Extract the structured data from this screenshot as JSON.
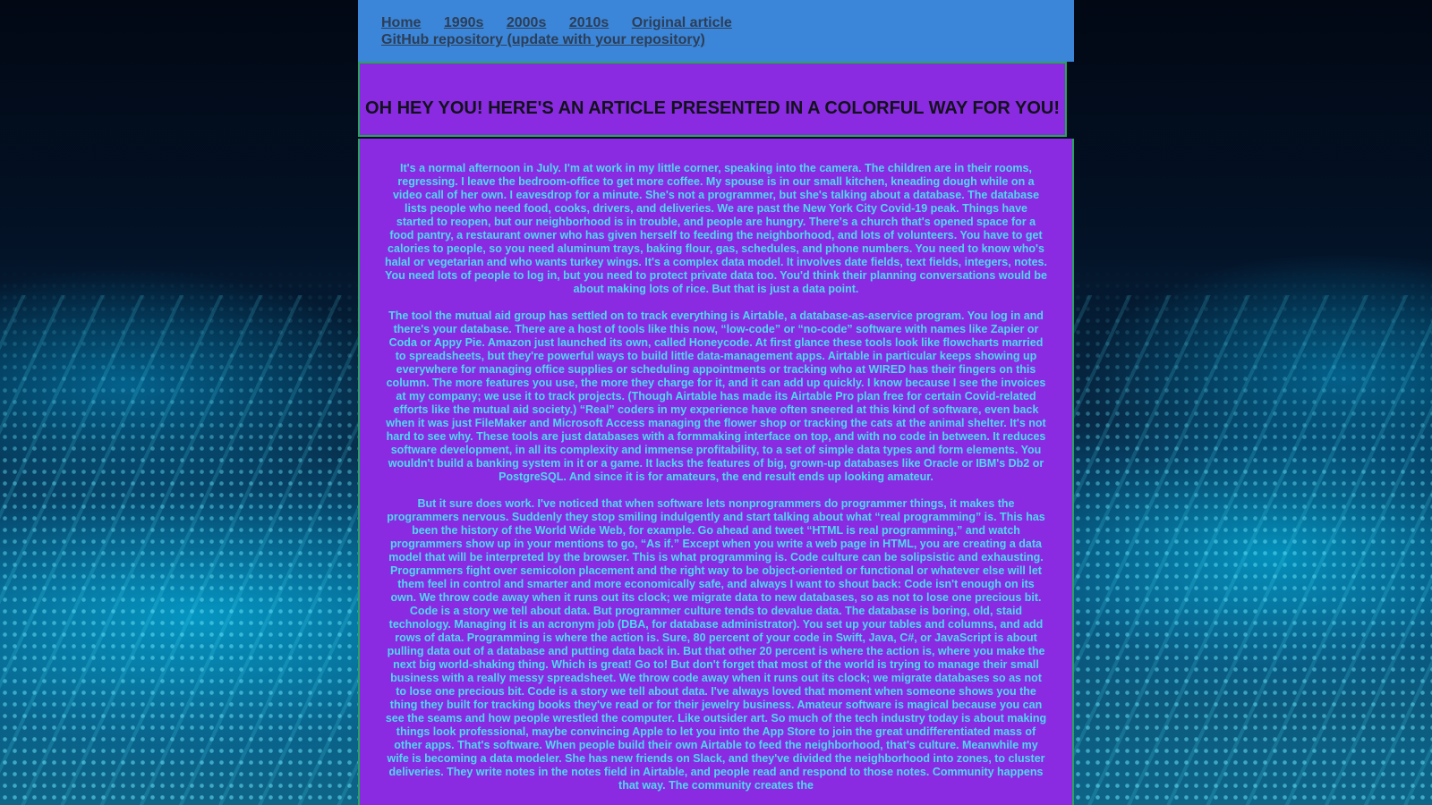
{
  "nav": {
    "links": [
      "Home",
      "1990s",
      "2000s",
      "2010s",
      "Original article"
    ],
    "repo_link": "GitHub repository (update with your repository)"
  },
  "banner": {
    "title": "OH HEY YOU! HERE'S AN ARTICLE PRESENTED IN A COLORFUL WAY FOR YOU!"
  },
  "article": {
    "paragraphs": [
      "It's a normal afternoon in July. I'm at work in my little corner, speaking into the camera. The children are in their rooms, regressing. I leave the bedroom-office to get more coffee. My spouse is in our small kitchen, kneading dough while on a video call of her own. I eavesdrop for a minute. She's not a programmer, but she's talking about a database. The database lists people who need food, cooks, drivers, and deliveries. We are past the New York City Covid-19 peak. Things have started to reopen, but our neighborhood is in trouble, and people are hungry. There's a church that's opened space for a food pantry, a restaurant owner who has given herself to feeding the neighborhood, and lots of volunteers. You have to get calories to people, so you need aluminum trays, baking flour, gas, schedules, and phone numbers. You need to know who's halal or vegetarian and who wants turkey wings. It's a complex data model. It involves date fields, text fields, integers, notes. You need lots of people to log in, but you need to protect private data too. You'd think their planning conversations would be about making lots of rice. But that is just a data point.",
      "The tool the mutual aid group has settled on to track everything is Airtable, a database-as-aservice program. You log in and there's your database. There are a host of tools like this now, “low-code” or “no-code” software with names like Zapier or Coda or Appy Pie. Amazon just launched its own, called Honeycode. At first glance these tools look like flowcharts married to spreadsheets, but they're powerful ways to build little data-management apps. Airtable in particular keeps showing up everywhere for managing office supplies or scheduling appointments or tracking who at WIRED has their fingers on this column. The more features you use, the more they charge for it, and it can add up quickly. I know because I see the invoices at my company; we use it to track projects. (Though Airtable has made its Airtable Pro plan free for certain Covid-related efforts like the mutual aid society.) “Real” coders in my experience have often sneered at this kind of software, even back when it was just FileMaker and Microsoft Access managing the flower shop or tracking the cats at the animal shelter. It's not hard to see why. These tools are just databases with a formmaking interface on top, and with no code in between. It reduces software development, in all its complexity and immense profitability, to a set of simple data types and form elements. You wouldn't build a banking system in it or a game. It lacks the features of big, grown-up databases like Oracle or IBM's Db2 or PostgreSQL. And since it is for amateurs, the end result ends up looking amateur.",
      "But it sure does work. I've noticed that when software lets nonprogrammers do programmer things, it makes the programmers nervous. Suddenly they stop smiling indulgently and start talking about what “real programming” is. This has been the history of the World Wide Web, for example. Go ahead and tweet “HTML is real programming,” and watch programmers show up in your mentions to go, “As if.” Except when you write a web page in HTML, you are creating a data model that will be interpreted by the browser. This is what programming is. Code culture can be solipsistic and exhausting. Programmers fight over semicolon placement and the right way to be object-oriented or functional or whatever else will let them feel in control and smarter and more economically safe, and always I want to shout back: Code isn't enough on its own. We throw code away when it runs out its clock; we migrate data to new databases, so as not to lose one precious bit. Code is a story we tell about data. But programmer culture tends to devalue data. The database is boring, old, staid technology. Managing it is an acronym job (DBA, for database administrator). You set up your tables and columns, and add rows of data. Programming is where the action is. Sure, 80 percent of your code in Swift, Java, C#, or JavaScript is about pulling data out of a database and putting data back in. But that other 20 percent is where the action is, where you make the next big world-shaking thing. Which is great! Go to! But don't forget that most of the world is trying to manage their small business with a really messy spreadsheet. We throw code away when it runs out its clock; we migrate databases so as not to lose one precious bit. Code is a story we tell about data. I've always loved that moment when someone shows you the thing they built for tracking books they've read or for their jewelry business. Amateur software is magical because you can see the seams and how people wrestled the computer. Like outsider art. So much of the tech industry today is about making things look professional, maybe convincing Apple to let you into the App Store to join the great undifferentiated mass of other apps. That's software. When people build their own Airtable to feed the neighborhood, that's culture. Meanwhile my wife is becoming a data modeler. She has new friends on Slack, and they've divided the neighborhood into zones, to cluster deliveries. They write notes in the notes field in Airtable, and people read and respond to those notes. Community happens that way. The community creates the"
    ]
  },
  "theme": {
    "nav_bg": "#3b86d8",
    "panel_bg": "#8a2be2",
    "border": "#27a55c",
    "article_text": "#4fd9ee",
    "title_text": "#12121c"
  }
}
